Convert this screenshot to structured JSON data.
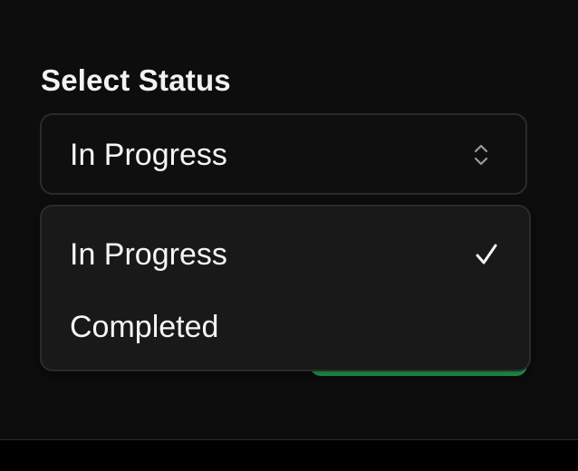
{
  "form": {
    "label": "Select Status",
    "select": {
      "value": "In Progress",
      "icon": "chevron-up-down-icon"
    },
    "dropdown": {
      "options": [
        {
          "label": "In Progress",
          "selected": true,
          "icon": "check-icon"
        },
        {
          "label": "Completed",
          "selected": false
        }
      ]
    },
    "submit_button_color": "#22b45a"
  },
  "colors": {
    "background": "#0d0d0d",
    "menu_background": "#191919",
    "border": "#2b2b2b",
    "text": "#f5f5f5"
  }
}
